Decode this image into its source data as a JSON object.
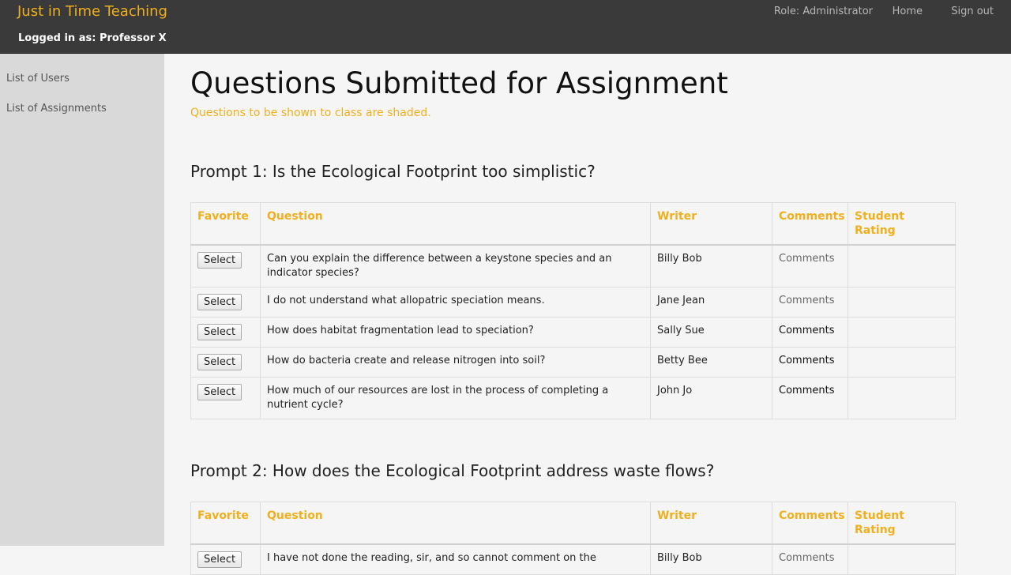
{
  "header": {
    "brand": "Just in Time Teaching",
    "logged_in": "Logged in as: Professor X",
    "role": "Role: Administrator",
    "home": "Home",
    "sign_out": "Sign out"
  },
  "sidebar": {
    "items": [
      {
        "label": "List of Users"
      },
      {
        "label": "List of Assignments"
      }
    ]
  },
  "main": {
    "title": "Questions Submitted for Assignment",
    "subtitle": "Questions to be shown to class are shaded.",
    "columns": [
      "Favorite",
      "Question",
      "Writer",
      "Comments",
      "Student Rating"
    ],
    "prompts": [
      {
        "title": "Prompt 1: Is the Ecological Footprint too simplistic?",
        "rows": [
          {
            "button": "Select",
            "question": "Can you explain the difference between a keystone species and an indicator species?",
            "writer": "Billy Bob",
            "comments": "Comments",
            "rating": ""
          },
          {
            "button": "Select",
            "question": "I do not understand what allopatric speciation means.",
            "writer": "Jane Jean",
            "comments": "Comments",
            "rating": ""
          },
          {
            "button": "Select",
            "question": "How does habitat fragmentation lead to speciation?",
            "writer": "Sally Sue",
            "comments": "Comments",
            "rating": ""
          },
          {
            "button": "Select",
            "question": "How do bacteria create and release nitrogen into soil?",
            "writer": "Betty Bee",
            "comments": "Comments",
            "rating": ""
          },
          {
            "button": "Select",
            "question": "How much of our resources are lost in the process of completing a nutrient cycle?",
            "writer": "John Jo",
            "comments": "Comments",
            "rating": ""
          }
        ]
      },
      {
        "title": "Prompt 2: How does the Ecological Footprint address waste flows?",
        "rows": [
          {
            "button": "Select",
            "question": "I have not done the reading, sir, and so cannot comment on the",
            "writer": "Billy Bob",
            "comments": "Comments",
            "rating": ""
          }
        ]
      }
    ]
  },
  "colors": {
    "accent": "#f0b01e",
    "topbar": "#3a3a3a",
    "sidebar": "#d9d9d9",
    "background": "#f5f5f5"
  }
}
